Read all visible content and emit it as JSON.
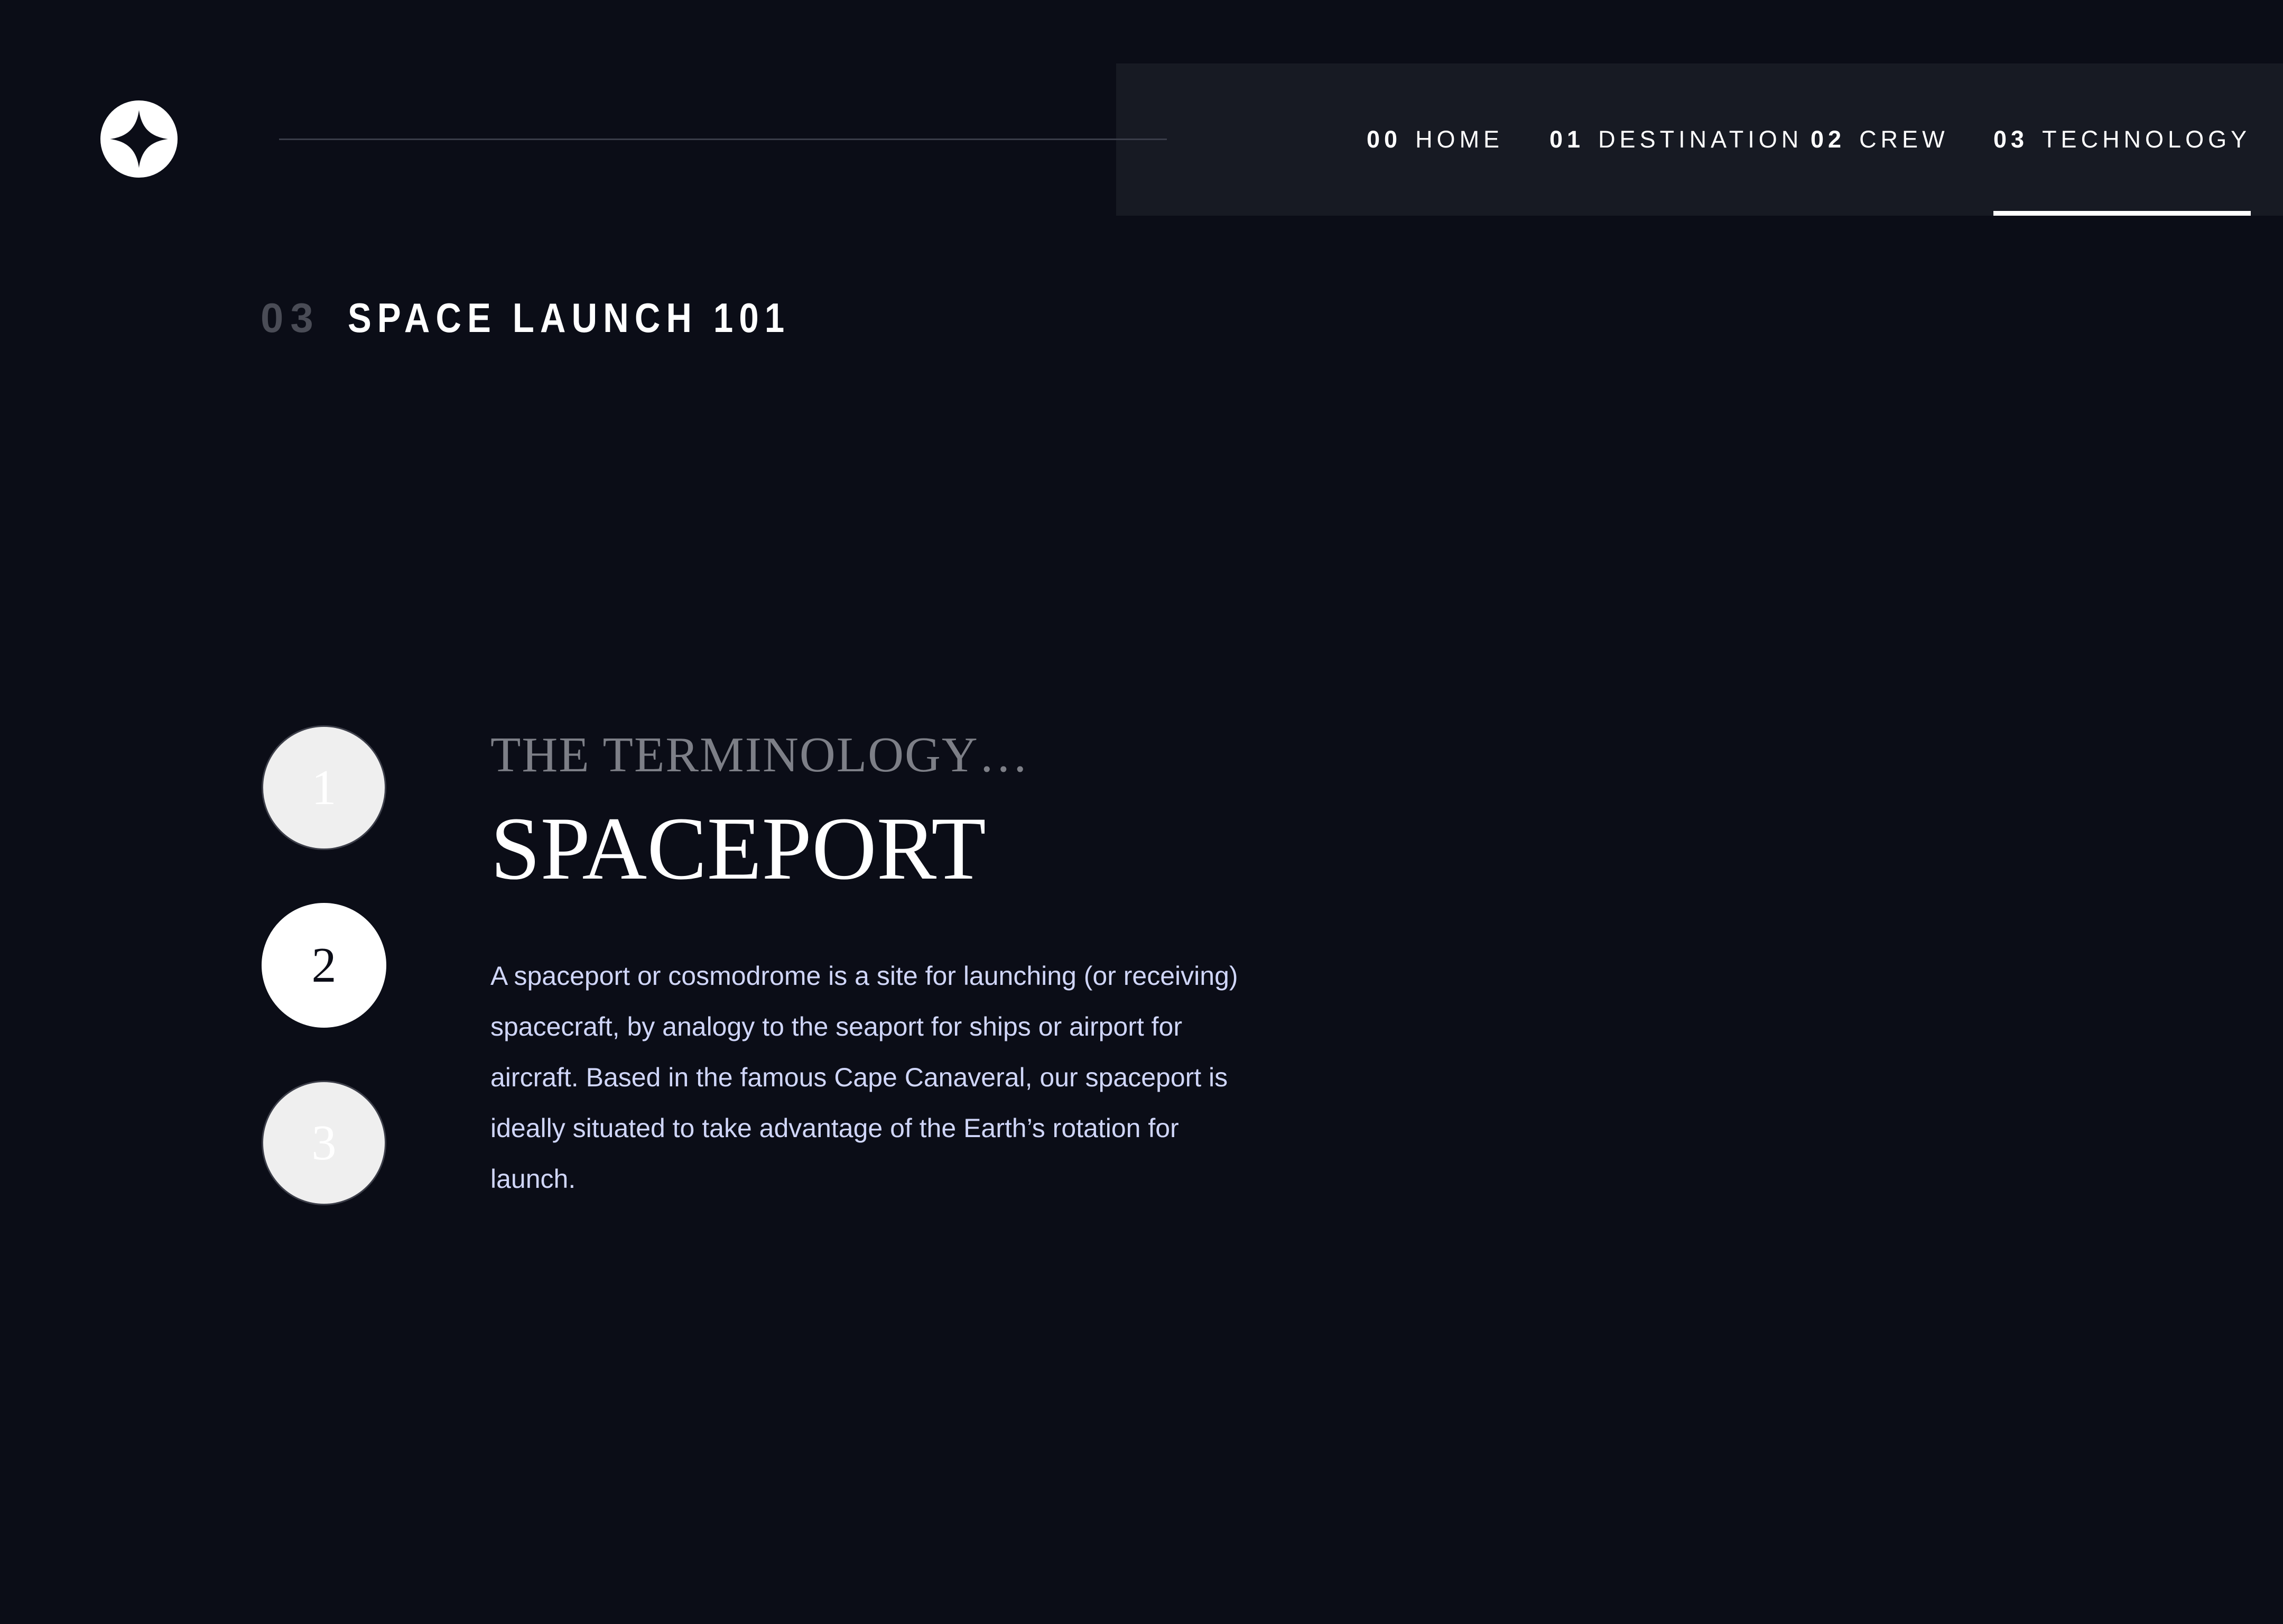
{
  "logo": {
    "icon": "star-logo-icon"
  },
  "nav": {
    "items": [
      {
        "num": "00",
        "label": "HOME",
        "active": false
      },
      {
        "num": "01",
        "label": "DESTINATION",
        "active": false
      },
      {
        "num": "02",
        "label": "CREW",
        "active": false
      },
      {
        "num": "03",
        "label": "TECHNOLOGY",
        "active": true
      }
    ]
  },
  "page": {
    "num": "03",
    "title": "SPACE LAUNCH 101"
  },
  "steps": [
    {
      "label": "1",
      "active": false
    },
    {
      "label": "2",
      "active": true
    },
    {
      "label": "3",
      "active": false
    }
  ],
  "content": {
    "eyebrow": "THE TERMINOLOGY…",
    "title": "SPACEPORT",
    "description": "A spaceport or cosmodrome is a site for launching (or receiving) spacecraft, by analogy to the seaport for ships or airport for aircraft. Based in the famous Cape Canaveral, our spaceport is ideally situated to take advantage of the Earth’s rotation for launch."
  },
  "colors": {
    "background": "#0b0d17",
    "nav_background": "#171a23",
    "accent_text": "#d0d6f9",
    "muted": "#4a4c56"
  }
}
